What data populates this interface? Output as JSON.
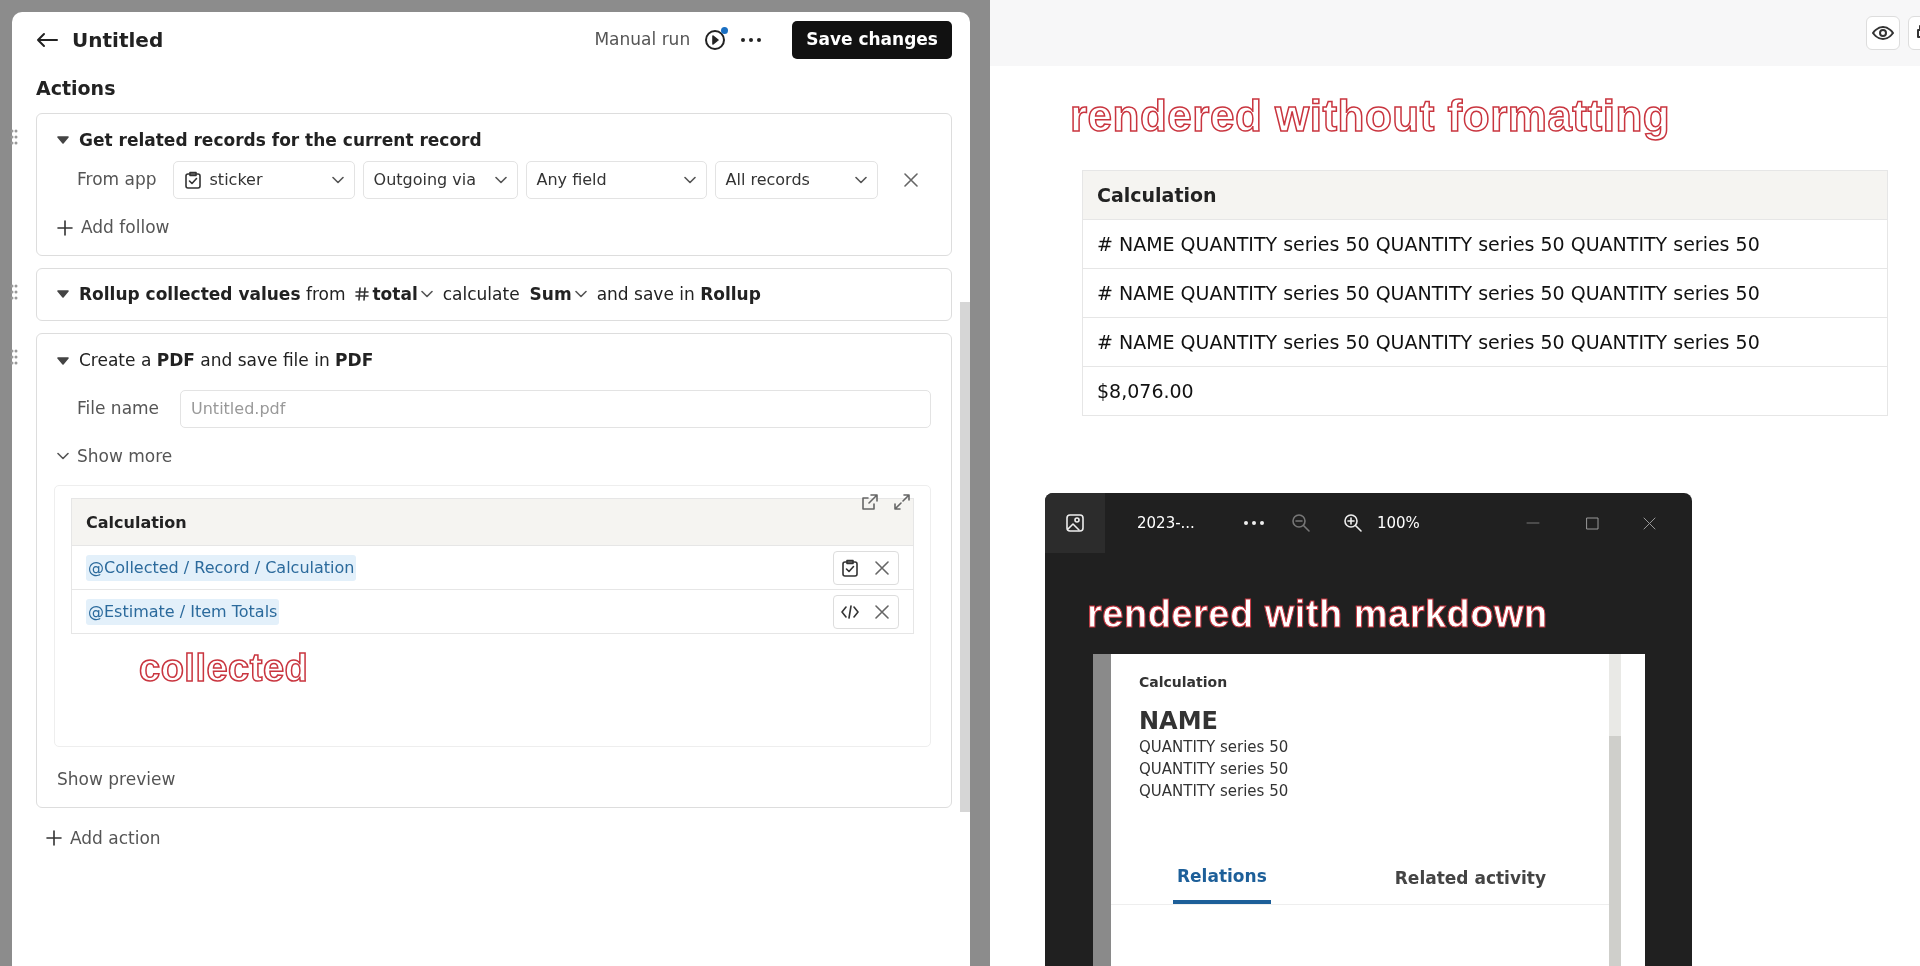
{
  "editor": {
    "title": "Untitled",
    "manual_run": "Manual run",
    "run_indicator": true,
    "save_button": "Save changes",
    "section_title": "Actions",
    "actions": [
      {
        "kind": "related",
        "title": "Get related records for the current record",
        "from_label": "From app",
        "selects": [
          {
            "label": "sticker",
            "kind": "app"
          },
          {
            "label": "Outgoing via",
            "kind": "plain"
          },
          {
            "label": "Any field",
            "kind": "plain"
          },
          {
            "label": "All records",
            "kind": "plain"
          }
        ],
        "add_follow": "Add follow"
      },
      {
        "kind": "rollup",
        "parts": [
          {
            "kind": "text",
            "text": "**Rollup collected values** from"
          },
          {
            "kind": "number_field",
            "text": "total"
          },
          {
            "kind": "text",
            "text": "calculate"
          },
          {
            "kind": "dropdown",
            "text": "Sum"
          },
          {
            "kind": "text",
            "text": "and save in **Rollup**"
          }
        ]
      },
      {
        "kind": "pdf",
        "title": "Create a **PDF** and save file in **PDF**",
        "file_label": "File name",
        "file_placeholder": "Untitled.pdf",
        "show_more": "Show more",
        "template": {
          "header": "Calculation",
          "rows": [
            {
              "text": "@Collected / Record / Calculation",
              "kind": "record"
            },
            {
              "text": "@Estimate / Item Totals",
              "kind": "code"
            }
          ]
        },
        "annotation": "collected",
        "show_preview": "Show preview"
      }
    ],
    "add_action": "Add action"
  },
  "preview": {
    "annotation": "rendered without formatting",
    "table": {
      "header": "Calculation",
      "rows": [
        "# NAME QUANTITY series 50 QUANTITY series 50 QUANTITY series 50",
        "# NAME QUANTITY series 50 QUANTITY series 50 QUANTITY series 50",
        "# NAME QUANTITY series 50 QUANTITY series 50 QUANTITY series 50",
        "$8,076.00"
      ]
    }
  },
  "viewer": {
    "file_name": "2023-...",
    "zoom": "100%",
    "annotation": "rendered with markdown",
    "document": {
      "label": "Calculation",
      "heading": "NAME",
      "lines": [
        "QUANTITY series 50",
        "QUANTITY series 50",
        "QUANTITY series 50"
      ],
      "tabs": [
        {
          "label": "Relations",
          "selected": true
        },
        {
          "label": "Related activity",
          "selected": false
        }
      ]
    }
  }
}
